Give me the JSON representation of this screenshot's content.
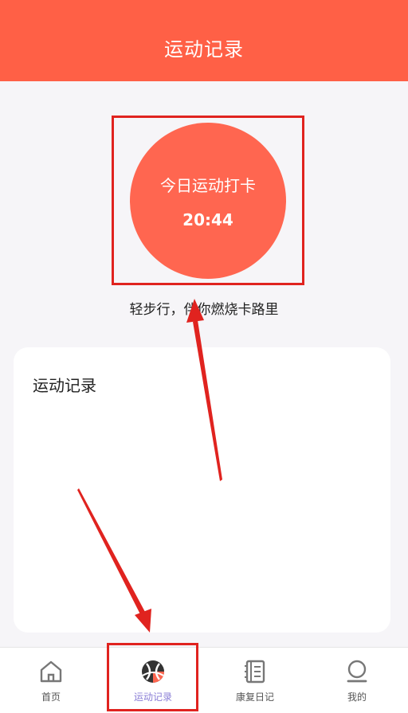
{
  "header": {
    "title": "运动记录"
  },
  "checkin": {
    "label": "今日运动打卡",
    "time": "20:44"
  },
  "slogan": "轻步行，伴你燃烧卡路里",
  "records_card": {
    "title": "运动记录"
  },
  "tabbar": {
    "items": [
      {
        "label": "首页",
        "icon": "home-icon"
      },
      {
        "label": "运动记录",
        "icon": "sport-ball-icon"
      },
      {
        "label": "康复日记",
        "icon": "notebook-icon"
      },
      {
        "label": "我的",
        "icon": "profile-icon"
      }
    ],
    "active_index": 1
  },
  "colors": {
    "brand": "#ff6046",
    "checkin_circle": "#ff6650",
    "annotation": "#e0231f",
    "active_tab": "#8a7ed6"
  }
}
